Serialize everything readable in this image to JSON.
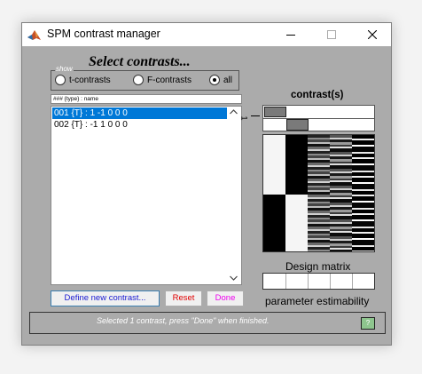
{
  "window": {
    "title": "SPM contrast manager",
    "controls": {
      "minimize": "minimize-icon",
      "maximize": "maximize-icon",
      "close": "close-icon"
    }
  },
  "heading": "Select contrasts...",
  "show_group": {
    "legend": "show",
    "options": [
      {
        "label": "t-contrasts",
        "selected": false
      },
      {
        "label": "F-contrasts",
        "selected": false
      },
      {
        "label": "all",
        "selected": true
      }
    ]
  },
  "contrast_list": {
    "header": "### {type} : name",
    "items": [
      {
        "label": "001 {T} : 1 -1 0 0 0",
        "selected": true
      },
      {
        "label": "002 {T} : -1 1 0 0 0",
        "selected": false
      }
    ]
  },
  "buttons": {
    "define": "Define new contrast...",
    "reset": "Reset",
    "done": "Done"
  },
  "right_panel": {
    "contrasts_title": "contrast(s)",
    "contrast_index": "1",
    "design_matrix_label": "Design matrix",
    "param_estimability_label": "parameter estimability"
  },
  "status": {
    "text": "Selected 1 contrast, press \"Done\" when finished."
  },
  "colors": {
    "window_bg": "#ababab",
    "selection": "#0078d7",
    "define_text": "#1a1ad2",
    "reset_text": "#e00000",
    "done_text": "#ee00ee"
  }
}
